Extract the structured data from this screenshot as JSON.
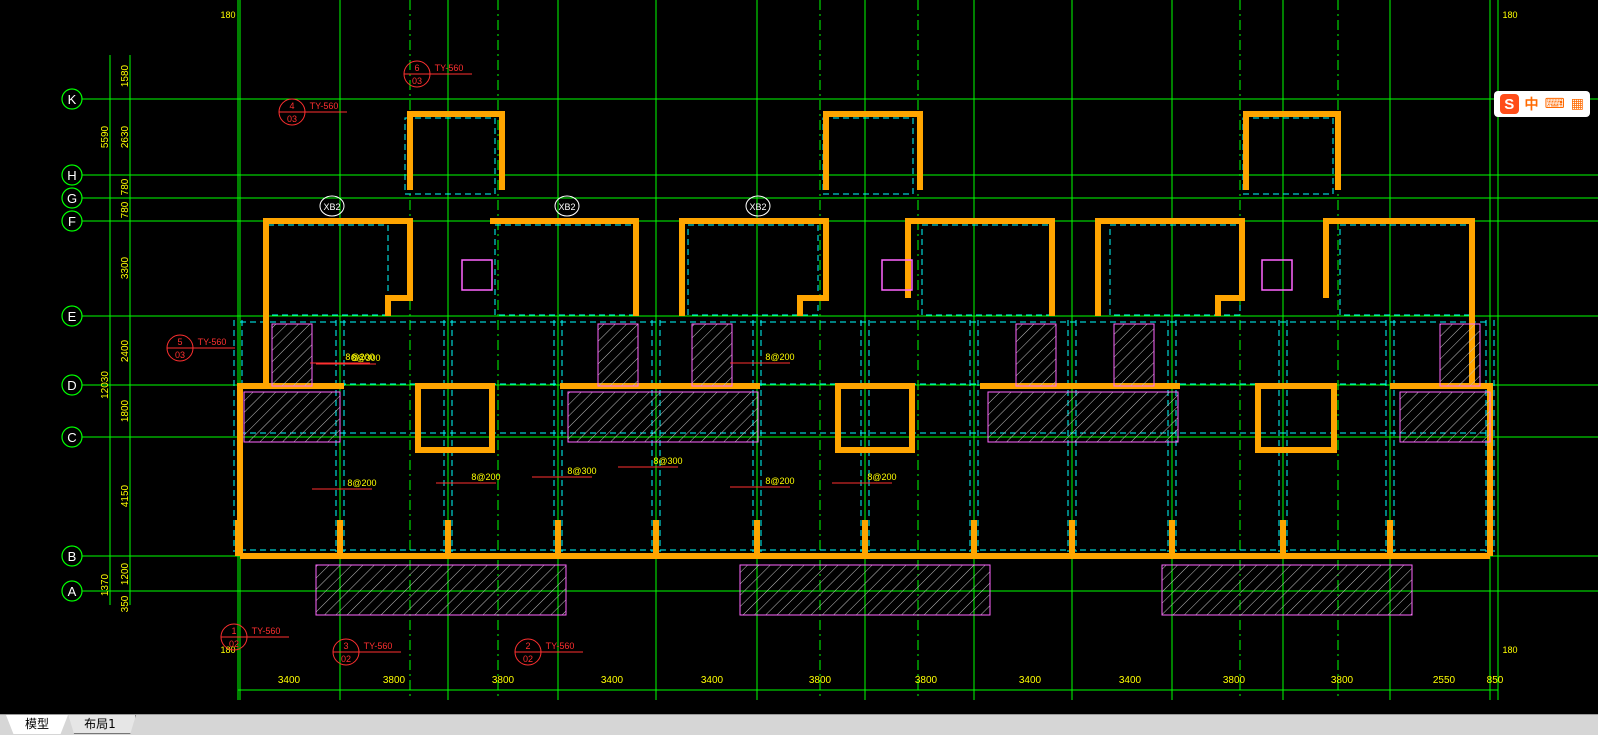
{
  "colors": {
    "background": "#000000",
    "grid_line": "#00ff00",
    "wall": "#ffa500",
    "dashed_beam": "#00ffff",
    "dimension_text": "#ffff00",
    "annotation": "#ff3030",
    "hatch": "#ff66ff"
  },
  "axes": {
    "rows": [
      {
        "label": "K"
      },
      {
        "label": "H"
      },
      {
        "label": "G"
      },
      {
        "label": "F"
      },
      {
        "label": "E"
      },
      {
        "label": "D"
      },
      {
        "label": "C"
      },
      {
        "label": "B"
      },
      {
        "label": "A"
      }
    ]
  },
  "left_dims": {
    "outer_total": "12030",
    "outer_top": "5590",
    "segments": [
      "1580",
      "2630",
      "780",
      "780",
      "3300",
      "2400",
      "1800",
      "4150",
      "1200",
      "350"
    ],
    "outer_bottom": "1370"
  },
  "bottom_dims": [
    "3400",
    "3800",
    "3800",
    "3400",
    "3400",
    "3800",
    "3800",
    "3400",
    "3400",
    "3800",
    "3800",
    "2550",
    "850"
  ],
  "corner_labels": [
    "180",
    "180",
    "180",
    "180"
  ],
  "section_marks": [
    {
      "top": "4",
      "bottom": "03",
      "ref": "TY-560"
    },
    {
      "top": "6",
      "bottom": "03",
      "ref": "TY-560"
    },
    {
      "top": "5",
      "bottom": "03",
      "ref": "TY-560"
    },
    {
      "top": "1",
      "bottom": "02",
      "ref": "TY-560"
    },
    {
      "top": "3",
      "bottom": "02",
      "ref": "TY-560"
    },
    {
      "top": "2",
      "bottom": "02",
      "ref": "TY-560"
    }
  ],
  "tags": [
    "XB2",
    "XB2",
    "XB2"
  ],
  "rebar_notes": [
    "8@200",
    "8@200",
    "8@200",
    "8@300",
    "8@300",
    "8@200",
    "8@200",
    "8@200",
    "8@300"
  ],
  "ime": {
    "logo": "S",
    "items": [
      "中",
      "⌨",
      "▦"
    ]
  },
  "tabs": {
    "model": "模型",
    "layout": "布局1"
  }
}
